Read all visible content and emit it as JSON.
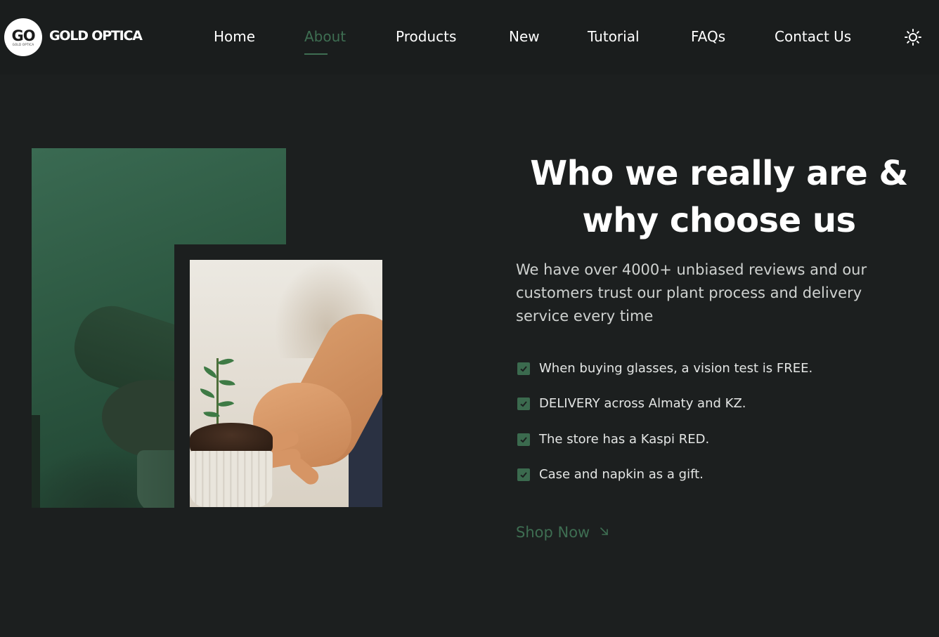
{
  "brand": {
    "logo_monogram": "GO",
    "logo_subtext": "GOLD OPTICA",
    "name": "GOLD OPTICA"
  },
  "nav": {
    "items": [
      {
        "label": "Home"
      },
      {
        "label": "About",
        "active": true
      },
      {
        "label": "Products"
      },
      {
        "label": "New"
      },
      {
        "label": "Tutorial"
      },
      {
        "label": "FAQs"
      },
      {
        "label": "Contact Us"
      }
    ],
    "theme_icon": "sun-icon"
  },
  "about": {
    "heading_line1": "Who we really are &",
    "heading_line2": "why choose us",
    "intro": "We have over 4000+ unbiased reviews and our customers trust our plant process and delivery service every time",
    "features": [
      "When buying glasses, a vision test is FREE.",
      "DELIVERY across Almaty and KZ.",
      "The store has a Kaspi RED.",
      "Case and napkin as a gift."
    ],
    "cta_label": "Shop Now",
    "cta_icon": "arrow-down-right-icon"
  },
  "colors": {
    "background": "#1c1f1f",
    "accent": "#3e6e52",
    "text": "#ffffff"
  }
}
